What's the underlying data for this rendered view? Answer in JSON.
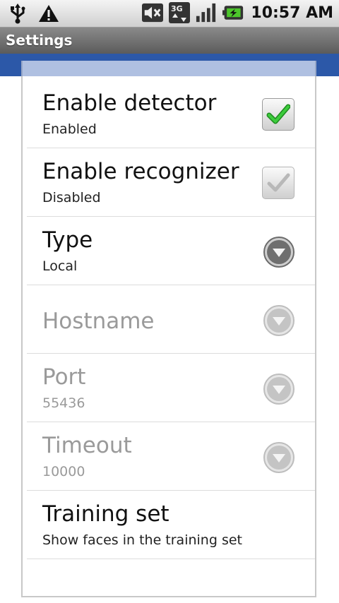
{
  "status_bar": {
    "time": "10:57 AM",
    "left_icons": [
      "usb-icon",
      "warning-icon"
    ],
    "right_icons": [
      "mute-icon",
      "3g-icon",
      "signal-icon",
      "battery-charging-icon"
    ]
  },
  "title_bar": {
    "title": "Settings"
  },
  "preferences": [
    {
      "title": "Enable detector",
      "summary": "Enabled",
      "widget": "checkbox",
      "checked": true,
      "enabled": true
    },
    {
      "title": "Enable recognizer",
      "summary": "Disabled",
      "widget": "checkbox",
      "checked": true,
      "enabled": false
    },
    {
      "title": "Type",
      "summary": "Local",
      "widget": "dropdown",
      "enabled": true
    },
    {
      "title": "Hostname",
      "summary": "",
      "widget": "dropdown",
      "enabled": false
    },
    {
      "title": "Port",
      "summary": "55436",
      "widget": "dropdown",
      "enabled": false
    },
    {
      "title": "Timeout",
      "summary": "10000",
      "widget": "dropdown",
      "enabled": false
    },
    {
      "title": "Training set",
      "summary": "Show faces in the training set",
      "widget": "none",
      "enabled": true
    }
  ],
  "colors": {
    "accent_blue": "#2c58a8",
    "checkmark_green": "#2fb52f",
    "disabled_text": "#9a9a9a"
  }
}
